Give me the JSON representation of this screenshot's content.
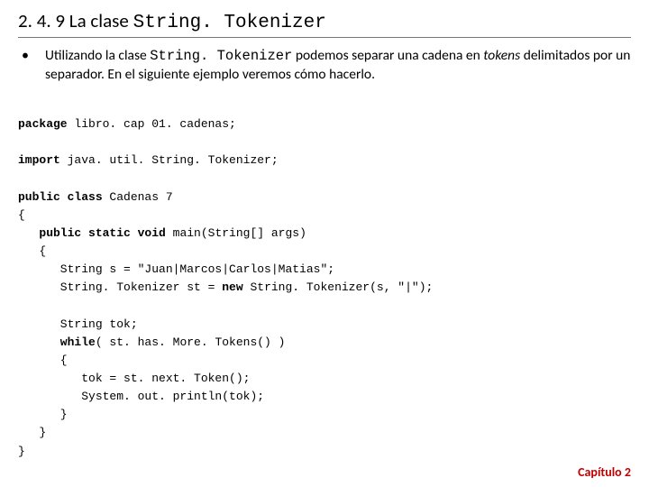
{
  "heading": {
    "number": "2. 4. 9",
    "text_before": " La clase ",
    "classname": "String. Tokenizer"
  },
  "bullet": {
    "dot": "•",
    "part1": "Utilizando la clase ",
    "code": "String. Tokenizer",
    "part2": " podemos separar una cadena en ",
    "italic": "tokens",
    "part3": " delimitados por un separador. En el siguiente ejemplo veremos cómo hacerlo."
  },
  "code": {
    "l1a": "package",
    "l1b": " libro. cap 01. cadenas;",
    "l2a": "import",
    "l2b": " java. util. String. Tokenizer;",
    "l3a": "public class ",
    "l3b": "Cadenas 7",
    "l4": "{",
    "l5a": "   public static void ",
    "l5b": "main(String[] args)",
    "l6": "   {",
    "l7": "      String s = \"Juan|Marcos|Carlos|Matias\";",
    "l8a": "      String. Tokenizer st = ",
    "l8b": "new ",
    "l8c": "String. Tokenizer(s, \"|\");",
    "l9": "      String tok;",
    "l10a": "      while",
    "l10b": "( st. has. More. Tokens() )",
    "l11": "      {",
    "l12": "         tok = st. next. Token();",
    "l13": "         System. out. println(tok);",
    "l14": "      }",
    "l15": "   }",
    "l16": "}"
  },
  "footer": {
    "label": "Capítulo ",
    "num": "2"
  }
}
